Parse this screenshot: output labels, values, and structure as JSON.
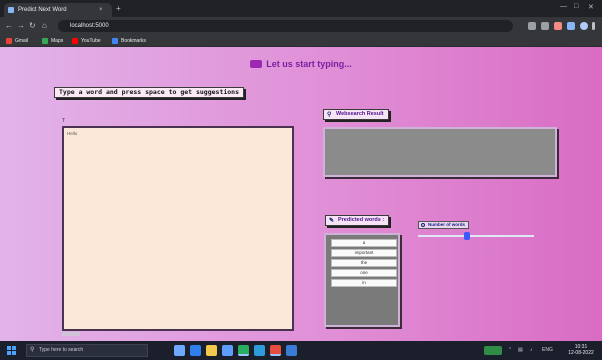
{
  "browser": {
    "tab_title": "Predict Next Word",
    "tab_close": "×",
    "new_tab": "+",
    "address": "localhost:5000",
    "bookmarks": [
      {
        "label": "Gmail",
        "color": "#ea4335"
      },
      {
        "label": "Maps",
        "color": "#34a853"
      },
      {
        "label": "YouTube",
        "color": "#ff0000"
      },
      {
        "label": "Bookmarks",
        "color": "#4285f4"
      }
    ],
    "colors": {
      "frame": "#202124",
      "toolbar": "#35363a"
    }
  },
  "app": {
    "heading": "Let us start typing...",
    "instruction": "Type a word and press space to get suggestions",
    "textarea_label": "T",
    "textarea_value": "Hello",
    "websearch_label": "Websearch Result",
    "predicted_label": "Predicted words :",
    "slider_label": "Number of words",
    "slider_value_fraction": 0.42,
    "predicted_words": [
      "a",
      "important",
      "the",
      "one",
      "in"
    ],
    "colors": {
      "heading": "#7a1fa2",
      "gradient_start": "#e2b3ea",
      "gradient_end": "#d96cc4",
      "textarea_bg": "#fbe8d8",
      "panel_gray": "#8b8b8b"
    }
  },
  "taskbar": {
    "search_placeholder": "Type here to search",
    "lang": "ENG",
    "time": "10:31",
    "date": "12-08-2022"
  }
}
